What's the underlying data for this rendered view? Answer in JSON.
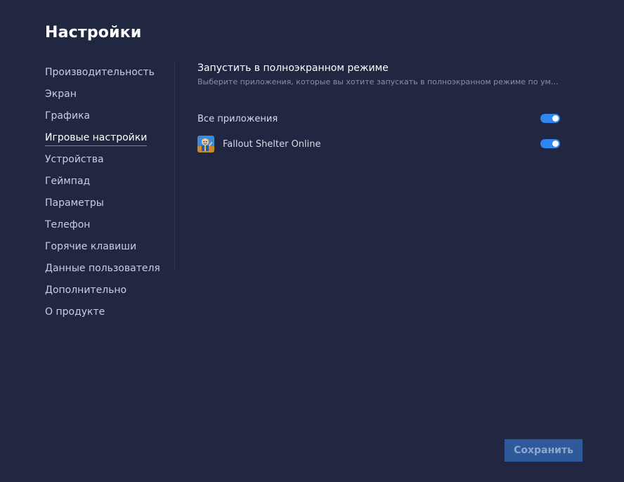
{
  "page": {
    "title": "Настройки"
  },
  "sidebar": {
    "items": [
      {
        "label": "Производительность",
        "active": false
      },
      {
        "label": "Экран",
        "active": false
      },
      {
        "label": "Графика",
        "active": false
      },
      {
        "label": "Игровые настройки",
        "active": true
      },
      {
        "label": "Устройства",
        "active": false
      },
      {
        "label": "Геймпад",
        "active": false
      },
      {
        "label": "Параметры",
        "active": false
      },
      {
        "label": "Телефон",
        "active": false
      },
      {
        "label": "Горячие клавиши",
        "active": false
      },
      {
        "label": "Данные пользователя",
        "active": false
      },
      {
        "label": "Дополнительно",
        "active": false
      },
      {
        "label": "О продукте",
        "active": false
      }
    ]
  },
  "fullscreen": {
    "title": "Запустить в полноэкранном режиме",
    "description": "Выберите приложения, которые вы хотите запускать в полноэкранном режиме по умолчанию",
    "all_apps": {
      "label": "Все приложения",
      "enabled": true
    },
    "apps": [
      {
        "name": "Fallout Shelter Online",
        "icon": "fallout-shelter-app-icon",
        "enabled": true
      }
    ]
  },
  "footer": {
    "save_label": "Сохранить"
  },
  "colors": {
    "background": "#222741",
    "accent": "#2f86f0",
    "save_button": "#2e5a9c"
  }
}
